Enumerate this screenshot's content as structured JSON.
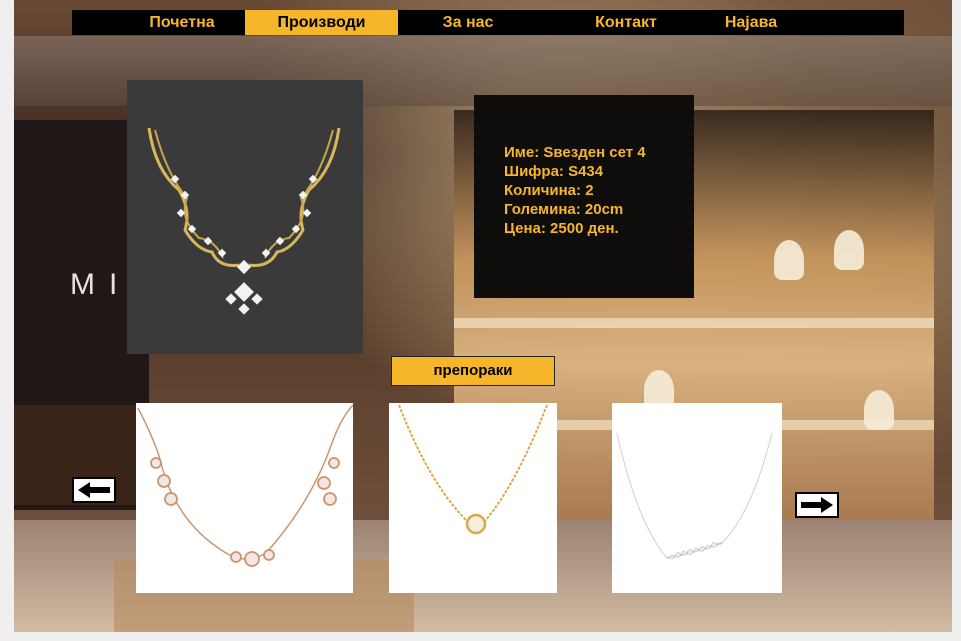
{
  "nav": {
    "items": [
      {
        "label": "Почетна",
        "active": false
      },
      {
        "label": "Производи",
        "active": true
      },
      {
        "label": "За нас",
        "active": false
      },
      {
        "label": "Контакт",
        "active": false
      },
      {
        "label": "Најава",
        "active": false
      }
    ]
  },
  "background": {
    "brand_text": "MI"
  },
  "product": {
    "name": "Име: Ѕвезден сет 4",
    "code": "Шифра: S434",
    "quantity": "Количина: 2",
    "size": "Големина: 20cm",
    "price": "Цена: 2500 ден."
  },
  "recommendations": {
    "label": "препораки",
    "items": [
      {
        "icon": "rose-gold-bezel-necklace-icon"
      },
      {
        "icon": "gold-solitaire-necklace-icon"
      },
      {
        "icon": "silver-diamond-bar-necklace-icon"
      }
    ]
  },
  "arrows": {
    "prev_icon": "arrow-left-icon",
    "next_icon": "arrow-right-icon"
  },
  "colors": {
    "accent": "#f6b62c",
    "nav_bg": "#000000",
    "info_bg": "#0f0d0b"
  }
}
